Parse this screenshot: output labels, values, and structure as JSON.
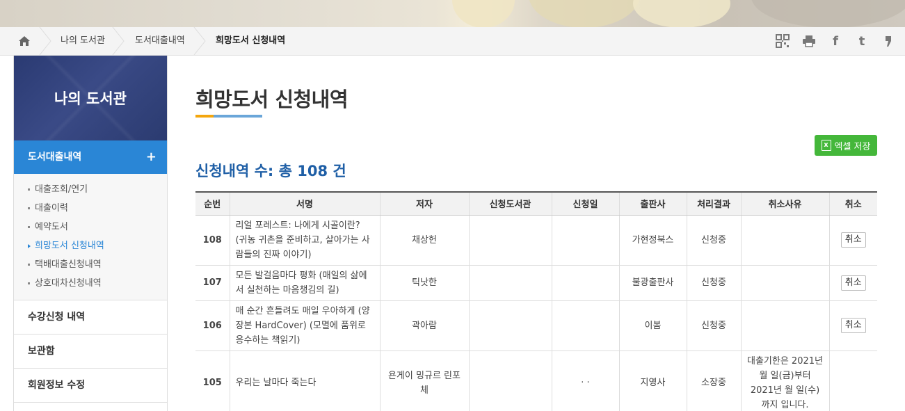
{
  "breadcrumb": {
    "items": [
      "나의 도서관",
      "도서대출내역",
      "희망도서 신청내역"
    ]
  },
  "tools": [
    "qr-code",
    "print",
    "facebook",
    "twitter",
    "blog"
  ],
  "sidebar": {
    "title": "나의 도서관",
    "active_section": "도서대출내역",
    "sub_items": [
      "대출조회/연기",
      "대출이력",
      "예약도서",
      "희망도서 신청내역",
      "택배대출신청내역",
      "상호대차신청내역"
    ],
    "active_sub": "희망도서 신청내역",
    "other_sections": [
      "수강신청 내역",
      "보관함",
      "회원정보 수정"
    ]
  },
  "main": {
    "title": "희망도서 신청내역",
    "excel_label": "엑셀 저장",
    "count_text": "신청내역 수: 총 108 건"
  },
  "table": {
    "headers": [
      "순번",
      "서명",
      "저자",
      "신청도서관",
      "신청일",
      "출판사",
      "처리결과",
      "취소사유",
      "취소"
    ],
    "rows": [
      {
        "no": "108",
        "title": "리얼 포레스트: 나에게 시골이란? (귀농 귀촌을 준비하고, 살아가는 사람들의 진짜 이야기)",
        "author": "채상헌",
        "library": "",
        "date": "",
        "publisher": "가현정북스",
        "status": "신청중",
        "reason": "",
        "cancel": "취소"
      },
      {
        "no": "107",
        "title": "모든 발걸음마다 평화 (매일의 삶에서 실천하는 마음챙김의 길)",
        "author": "틱낫한",
        "library": "",
        "date": "",
        "publisher": "불광출판사",
        "status": "신청중",
        "reason": "",
        "cancel": "취소"
      },
      {
        "no": "106",
        "title": "매 순간 흔들려도 매일 우아하게 (양장본 HardCover) (모멸에 품위로 응수하는 책읽기)",
        "author": "곽아람",
        "library": "",
        "date": "",
        "publisher": "이봄",
        "status": "신청중",
        "reason": "",
        "cancel": "취소"
      },
      {
        "no": "105",
        "title": "우리는 날마다 죽는다",
        "author": "욘게이 밍규르 린포체",
        "library": "",
        "date": "· ·",
        "publisher": "지영사",
        "status": "소장중",
        "reason": "대출기한은 2021년 월 일(금)부터 2021년 월 일(수)까지 입니다.",
        "cancel": ""
      }
    ]
  }
}
